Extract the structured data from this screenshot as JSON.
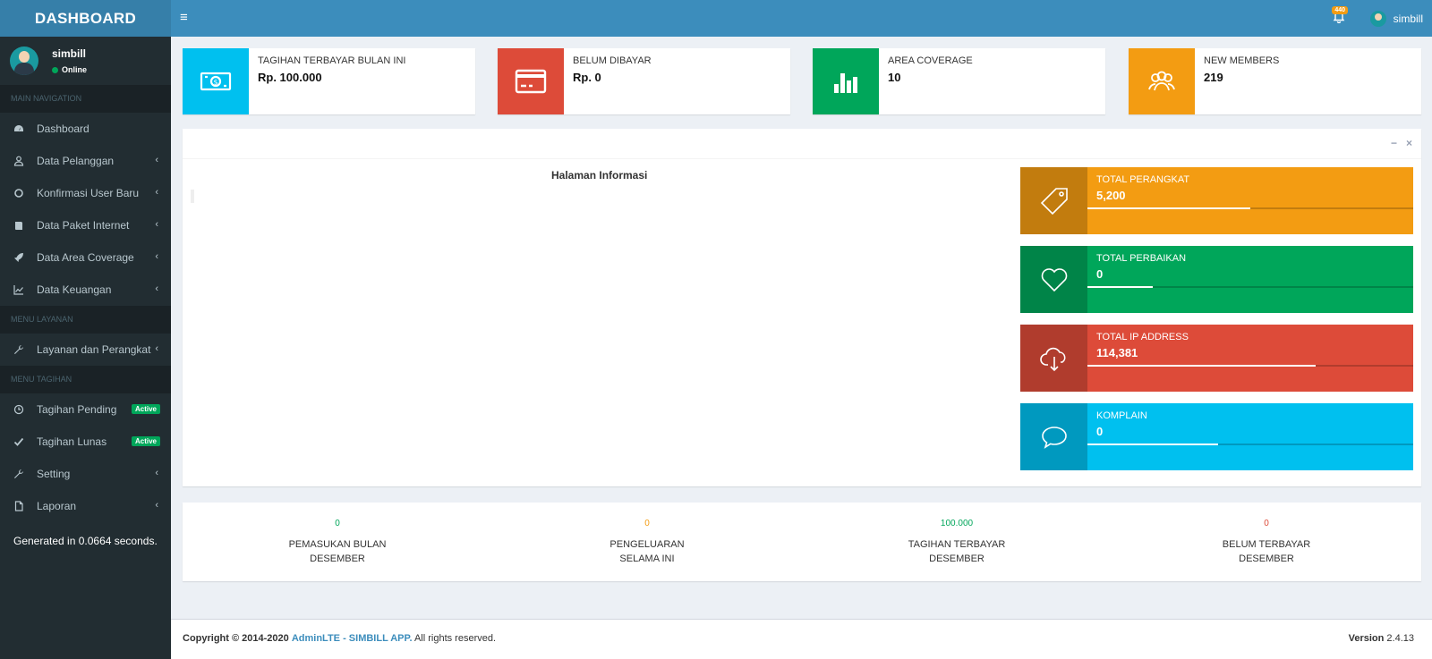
{
  "header": {
    "logo": "DASHBOARD",
    "menu_toggle": "≡",
    "notif_count": "440",
    "user": "simbill"
  },
  "sidebar": {
    "user_name": "simbill",
    "user_status": "Online",
    "sections": {
      "main": "MAIN NAVIGATION",
      "layanan": "MENU LAYANAN",
      "tagihan": "MENU TAGIHAN"
    },
    "items": [
      {
        "label": "Dashboard",
        "icon": "dashboard-icon"
      },
      {
        "label": "Data Pelanggan",
        "icon": "user-icon"
      },
      {
        "label": "Konfirmasi User Baru",
        "icon": "circle-icon"
      },
      {
        "label": "Data Paket Internet",
        "icon": "book-icon"
      },
      {
        "label": "Data Area Coverage",
        "icon": "rocket-icon"
      },
      {
        "label": "Data Keuangan",
        "icon": "line-chart-icon"
      },
      {
        "label": "Layanan dan Perangkat",
        "icon": "wrench-icon"
      },
      {
        "label": "Tagihan Pending",
        "icon": "clock-icon",
        "badge": "Active"
      },
      {
        "label": "Tagihan Lunas",
        "icon": "check-icon",
        "badge": "Active"
      },
      {
        "label": "Setting",
        "icon": "wrench-icon"
      },
      {
        "label": "Laporan",
        "icon": "file-icon"
      }
    ],
    "generated": "Generated in 0.0664 seconds."
  },
  "infoboxes": [
    {
      "title": "TAGIHAN TERBAYAR BULAN INI",
      "value": "Rp. 100.000",
      "color": "#00c0ef",
      "icon": "money-icon"
    },
    {
      "title": "BELUM DIBAYAR",
      "value": "Rp. 0",
      "color": "#dd4b39",
      "icon": "credit-card-icon"
    },
    {
      "title": "AREA COVERAGE",
      "value": "10",
      "color": "#00a65a",
      "icon": "bar-chart-icon"
    },
    {
      "title": "NEW MEMBERS",
      "value": "219",
      "color": "#f39c12",
      "icon": "users-icon"
    }
  ],
  "panel": {
    "title": "Halaman Informasi",
    "minimize": "−",
    "close": "×"
  },
  "stats": [
    {
      "title": "TOTAL PERANGKAT",
      "value": "5,200",
      "color": "#f39c12",
      "progress": 50,
      "icon": "tag-icon"
    },
    {
      "title": "TOTAL PERBAIKAN",
      "value": "0",
      "color": "#00a65a",
      "progress": 20,
      "icon": "heart-icon"
    },
    {
      "title": "TOTAL IP ADDRESS",
      "value": "114,381",
      "color": "#dd4b39",
      "progress": 70,
      "icon": "cloud-download-icon"
    },
    {
      "title": "KOMPLAIN",
      "value": "0",
      "color": "#00c0ef",
      "progress": 40,
      "icon": "comment-icon"
    }
  ],
  "summary": [
    {
      "number": "0",
      "line1": "PEMASUKAN BULAN",
      "line2": "DESEMBER",
      "color": "#00a65a"
    },
    {
      "number": "0",
      "line1": "PENGELUARAN",
      "line2": "SELAMA INI",
      "color": "#f39c12"
    },
    {
      "number": "100.000",
      "line1": "TAGIHAN TERBAYAR",
      "line2": "DESEMBER",
      "color": "#00a65a"
    },
    {
      "number": "0",
      "line1": "BELUM TERBAYAR",
      "line2": "DESEMBER",
      "color": "#dd4b39"
    }
  ],
  "footer": {
    "copyright": "Copyright © 2014-2020",
    "link1": "AdminLTE",
    "sep": " - ",
    "link2": "SIMBILL APP.",
    "rights": " All rights reserved.",
    "version_label": "Version",
    "version": "2.4.13"
  }
}
